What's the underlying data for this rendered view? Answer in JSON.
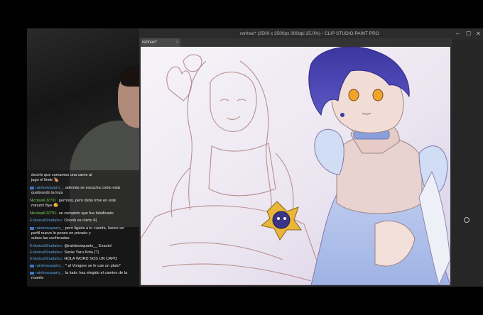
{
  "window": {
    "title": "renhao* (3500 x 3500px 300dpi 25.0%) - CLIP STUDIO PAINT PRO",
    "tab_label": "renhao*",
    "tab_close": "×",
    "controls": {
      "minimize": "–",
      "maximize": "☐",
      "close": "✕"
    }
  },
  "chat": {
    "messages": [
      {
        "user": "",
        "text": "decirle que comamos una carne al"
      },
      {
        "user": "",
        "text": "jugo el finde 🍖"
      },
      {
        "user": "rainbowquartz_:",
        "text": "además se escucha como está"
      },
      {
        "user": "",
        "text": "quebrando la loza"
      },
      {
        "user": "NicolasKJ2701:",
        "text": "permiso, pero debo irme en este"
      },
      {
        "user": "",
        "text": "minuto! Bye 😀"
      },
      {
        "user": "NicolasKJ2701:",
        "text": "se completo que fue falsificado"
      },
      {
        "user": "EnkaisuiShadatsu:",
        "text": "Ooooh es cierto 8("
      },
      {
        "user": "rainbowquartz_:",
        "text": "pero ligada a tu cuenta, haces un"
      },
      {
        "user": "",
        "text": "perfil nuevo lo pones en privado y"
      },
      {
        "user": "",
        "text": "subes las cochinadas"
      },
      {
        "user": "EnkaisuiShadatsu:",
        "text": "@rainbowquartz__ Exacto!"
      },
      {
        "user": "EnkaisuiShadatsu:",
        "text": "Serás Yaru Kota (?)"
      },
      {
        "user": "EnkaisuiShadatsu:",
        "text": "HOLA WORD SOS UN CAPO"
      },
      {
        "user": "rainbowquartz_:",
        "text": "* al Vongore se le cae un plato*"
      },
      {
        "user": "rainbowquartz_:",
        "text": "la kato: haz elegido el camino de la"
      },
      {
        "user": "",
        "text": "muerte"
      }
    ]
  },
  "colors": {
    "app_bg": "#2b2b2b",
    "chat_user": "#5aa3e0",
    "chat_user_alt": "#7ed957"
  }
}
